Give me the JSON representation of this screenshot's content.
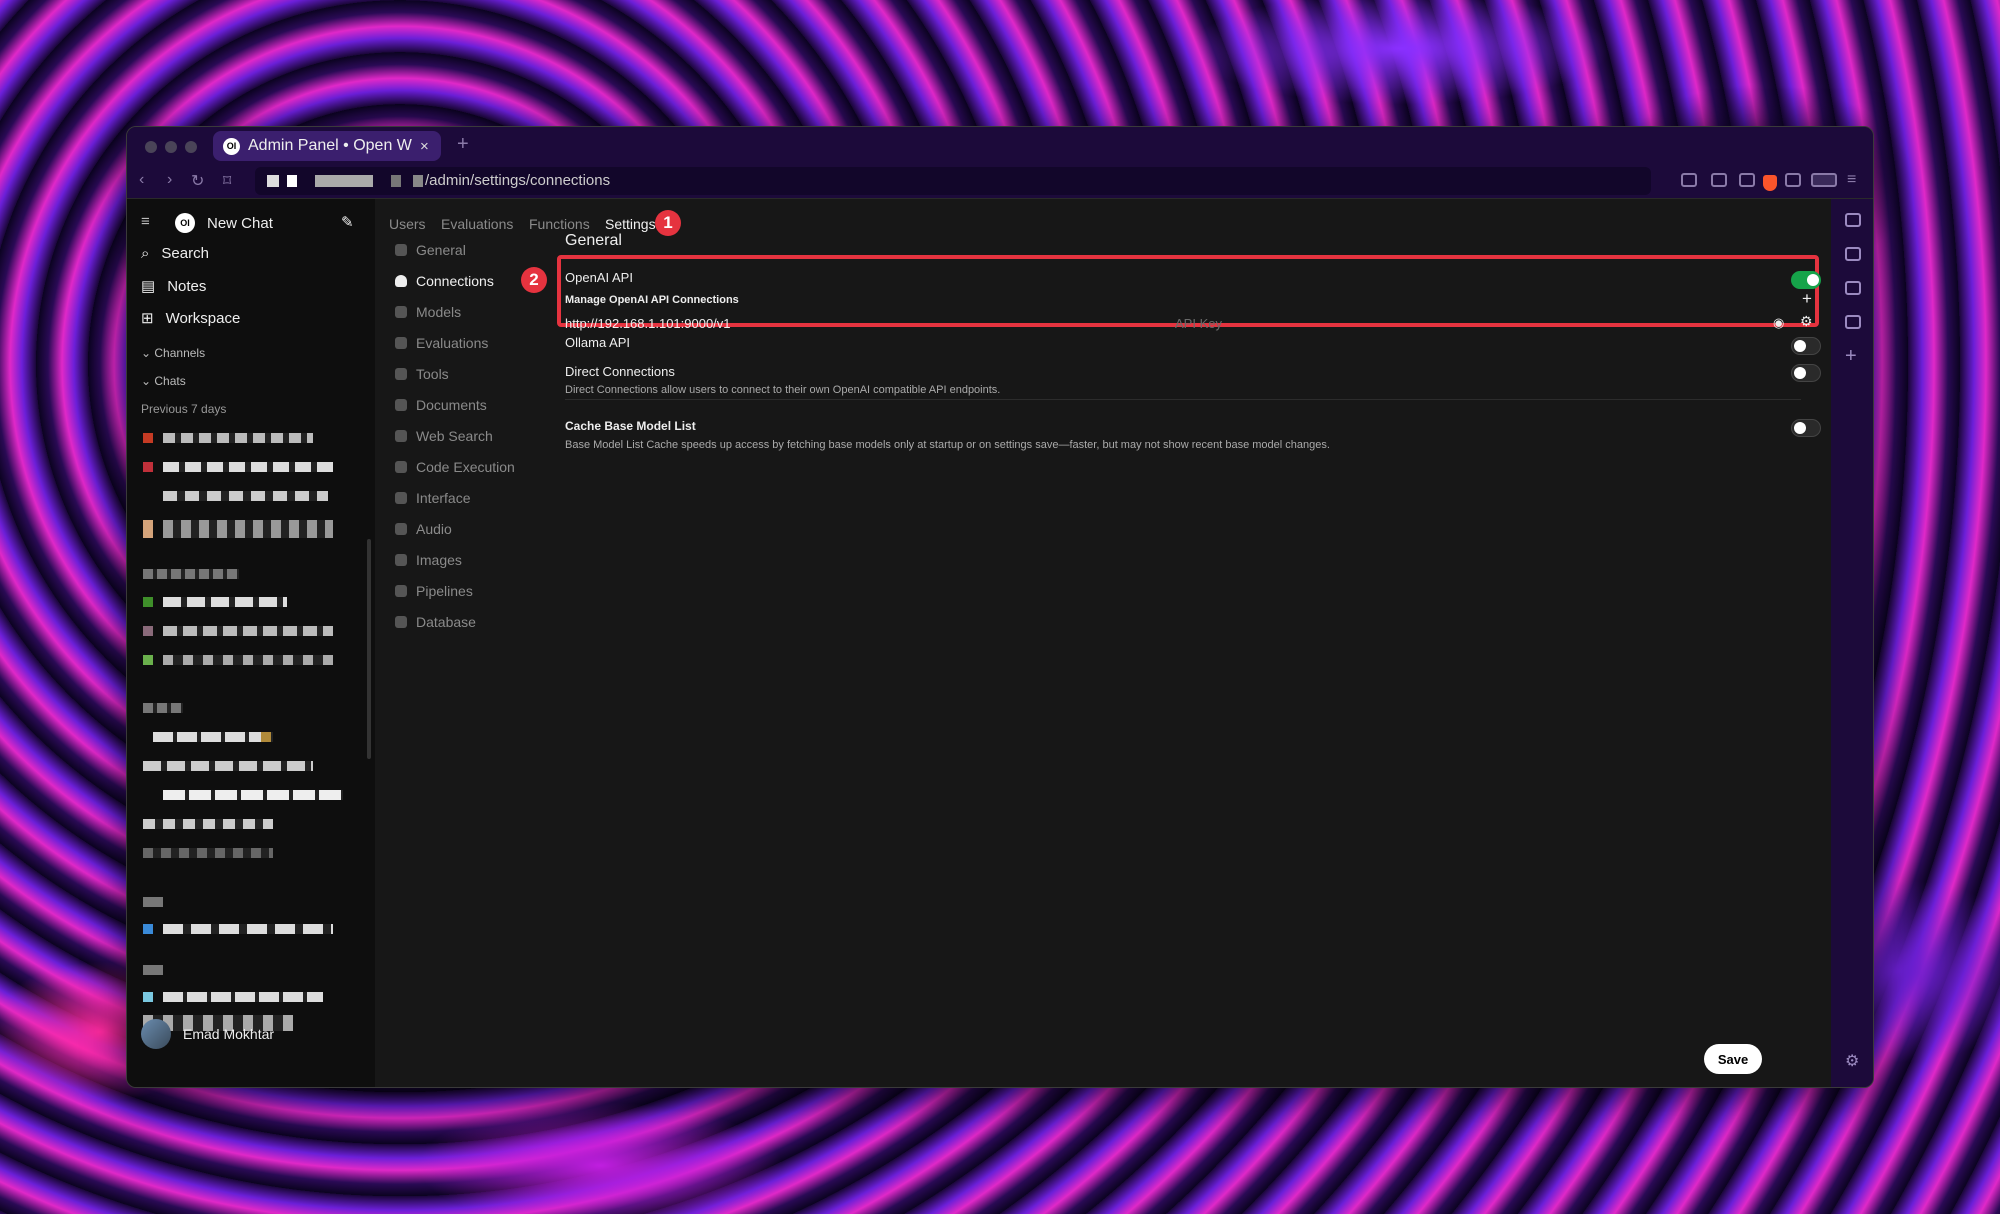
{
  "browser": {
    "tab_title": "Admin Panel • Open WebUI",
    "tab_logo": "OI",
    "tab_close": "×",
    "new_tab": "+",
    "url_path": "/admin/settings/connections"
  },
  "sidebar": {
    "new_chat": "New Chat",
    "logo": "OI",
    "items": [
      {
        "label": "Search",
        "icon": "search-icon"
      },
      {
        "label": "Notes",
        "icon": "notes-icon"
      },
      {
        "label": "Workspace",
        "icon": "workspace-icon"
      }
    ],
    "channels": "Channels",
    "chats": "Chats",
    "section_label": "Previous 7 days",
    "user_name": "Emad Mokhtar"
  },
  "admin_tabs": [
    "Users",
    "Evaluations",
    "Functions",
    "Settings"
  ],
  "annotations": {
    "badge1": "1",
    "badge2": "2",
    "color": "#e5333f"
  },
  "settings_nav": [
    "General",
    "Connections",
    "Models",
    "Evaluations",
    "Tools",
    "Documents",
    "Web Search",
    "Code Execution",
    "Interface",
    "Audio",
    "Images",
    "Pipelines",
    "Database"
  ],
  "content": {
    "heading": "General",
    "openai": {
      "title": "OpenAI API",
      "enabled": true,
      "manage_label": "Manage OpenAI API Connections",
      "add": "+",
      "url": "http://192.168.1.101:9000/v1",
      "api_key_placeholder": "API Key"
    },
    "ollama": {
      "title": "Ollama API",
      "enabled": false
    },
    "direct": {
      "title": "Direct Connections",
      "description": "Direct Connections allow users to connect to their own OpenAI compatible API endpoints.",
      "enabled": false
    },
    "cache": {
      "title": "Cache Base Model List",
      "description": "Base Model List Cache speeds up access by fetching base models only at startup or on settings save—faster, but may not show recent base model changes.",
      "enabled": false
    },
    "save": "Save"
  }
}
